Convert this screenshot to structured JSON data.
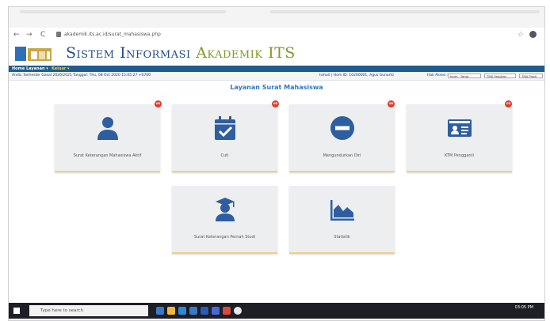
{
  "browser": {
    "url": "akademik.its.ac.id/surat_mahasiswa.php",
    "back_glyph": "←",
    "forward_glyph": "→",
    "reload_glyph": "C",
    "star_glyph": "☆"
  },
  "header": {
    "title_part1": "Sistem Informasi",
    "title_part2": "Akademik ITS"
  },
  "menu": {
    "items": [
      {
        "label": "Home"
      },
      {
        "label": "Layanan ▾"
      },
      {
        "label": "Keluar ▾"
      }
    ]
  },
  "info": {
    "left": "Anda: Semester Gasal 2020/2021 Tanggal: Thu, 08 Oct 2020 15:05:27 +0700",
    "middle": "Ismail | Hom ID: 10200001, Agus Gunarto",
    "right_label": "Hak Akses :",
    "select1": "Jenm · Tahat",
    "select2": "TMA Fakultas",
    "select3": "TMA Prodi"
  },
  "page": {
    "heading": "Layanan Surat Mahasiswa"
  },
  "cards": [
    {
      "label": "Surat Keterangan Mahasiswa Aktif",
      "icon": "person-icon",
      "badge": "GR"
    },
    {
      "label": "Cuti",
      "icon": "calendar-check-icon",
      "badge": "GR"
    },
    {
      "label": "Mengundurkan Diri",
      "icon": "minus-circle-icon",
      "badge": "GR"
    },
    {
      "label": "KTM Pengganti",
      "icon": "id-card-icon",
      "badge": "GR"
    },
    {
      "label": "Surat Keterangan Pernah Studi",
      "icon": "graduate-icon"
    },
    {
      "label": "Statistik",
      "icon": "area-chart-icon"
    }
  ],
  "taskbar": {
    "search_placeholder": "Type here to search",
    "time": "03:05 PM"
  },
  "colors": {
    "icon_blue": "#2f5ea0",
    "badge_red": "#e03b2b",
    "heading_blue": "#2b77c8",
    "menubar_blue": "#1f5d8f"
  }
}
